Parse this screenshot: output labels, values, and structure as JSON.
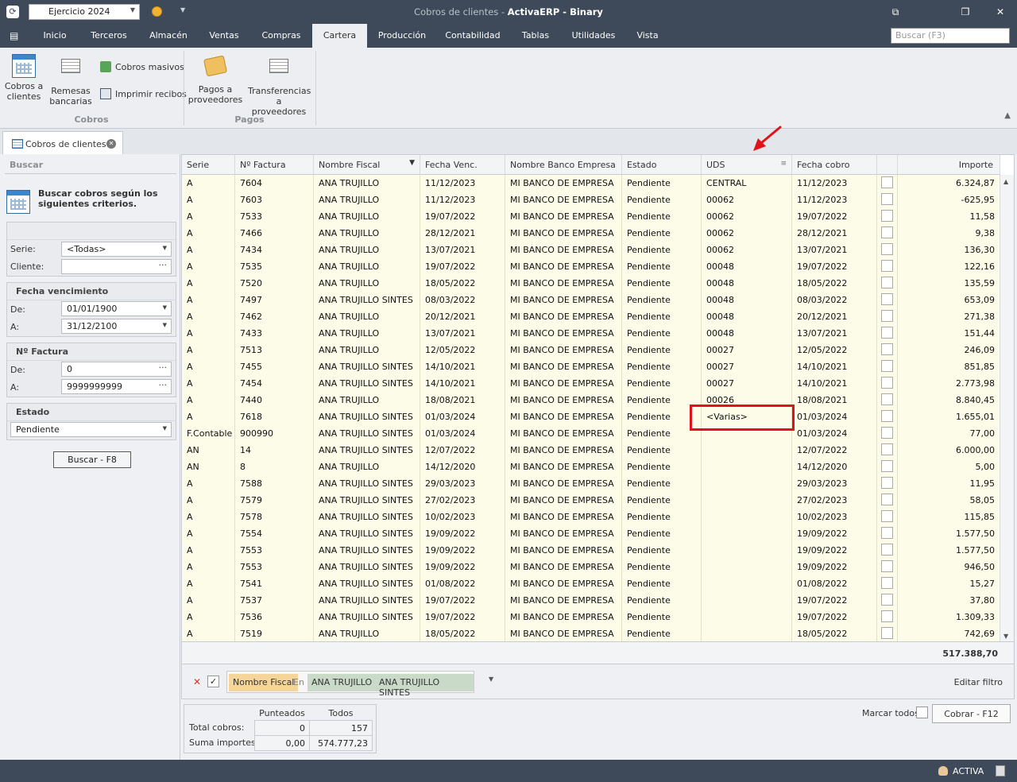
{
  "window": {
    "title_prefix": "Cobros de clientes - ",
    "title_app": "ActivaERP - Binary",
    "ejercicio": "Ejercicio 2024",
    "search_placeholder": "Buscar (F3)"
  },
  "menu": [
    "Inicio",
    "Terceros",
    "Almacén",
    "Ventas",
    "Compras",
    "Cartera",
    "Producción",
    "Contabilidad",
    "Tablas",
    "Utilidades",
    "Vista"
  ],
  "ribbon": {
    "cobros_clientes": "Cobros a clientes",
    "remesas": "Remesas bancarias",
    "cobros_masivos": "Cobros masivos",
    "imprimir_recibos": "Imprimir recibos",
    "group_cobros": "Cobros",
    "pagos_proveedores": "Pagos a proveedores",
    "transferencias": "Transferencias a proveedores",
    "group_pagos": "Pagos"
  },
  "tab": {
    "label": "Cobros de clientes"
  },
  "search_panel": {
    "title": "Buscar",
    "description": "Buscar cobros según los siguientes criterios.",
    "serie_label": "Serie:",
    "serie_value": "<Todas>",
    "cliente_label": "Cliente:",
    "cliente_value": "",
    "fecha_heading": "Fecha vencimiento",
    "de_label": "De:",
    "a_label": "A:",
    "fecha_de": "01/01/1900",
    "fecha_a": "31/12/2100",
    "factura_heading": "Nº Factura",
    "factura_de": "0",
    "factura_a": "9999999999",
    "estado_heading": "Estado",
    "estado_value": "Pendiente",
    "buscar_button": "Buscar - F8"
  },
  "grid": {
    "columns": [
      "Serie",
      "Nº Factura",
      "Nombre Fiscal",
      "Fecha Venc.",
      "Nombre Banco Empresa",
      "Estado",
      "UDS",
      "Fecha cobro",
      "",
      "Importe"
    ],
    "rows": [
      [
        "A",
        "7604",
        "ANA TRUJILLO",
        "11/12/2023",
        "MI BANCO DE EMPRESA",
        "Pendiente",
        "CENTRAL",
        "11/12/2023",
        "",
        "6.324,87"
      ],
      [
        "A",
        "7603",
        "ANA TRUJILLO",
        "11/12/2023",
        "MI BANCO DE EMPRESA",
        "Pendiente",
        "00062",
        "11/12/2023",
        "",
        "-625,95"
      ],
      [
        "A",
        "7533",
        "ANA TRUJILLO",
        "19/07/2022",
        "MI BANCO DE EMPRESA",
        "Pendiente",
        "00062",
        "19/07/2022",
        "",
        "11,58"
      ],
      [
        "A",
        "7466",
        "ANA TRUJILLO",
        "28/12/2021",
        "MI BANCO DE EMPRESA",
        "Pendiente",
        "00062",
        "28/12/2021",
        "",
        "9,38"
      ],
      [
        "A",
        "7434",
        "ANA TRUJILLO",
        "13/07/2021",
        "MI BANCO DE EMPRESA",
        "Pendiente",
        "00062",
        "13/07/2021",
        "",
        "136,30"
      ],
      [
        "A",
        "7535",
        "ANA TRUJILLO",
        "19/07/2022",
        "MI BANCO DE EMPRESA",
        "Pendiente",
        "00048",
        "19/07/2022",
        "",
        "122,16"
      ],
      [
        "A",
        "7520",
        "ANA TRUJILLO",
        "18/05/2022",
        "MI BANCO DE EMPRESA",
        "Pendiente",
        "00048",
        "18/05/2022",
        "",
        "135,59"
      ],
      [
        "A",
        "7497",
        "ANA TRUJILLO SINTES",
        "08/03/2022",
        "MI BANCO DE EMPRESA",
        "Pendiente",
        "00048",
        "08/03/2022",
        "",
        "653,09"
      ],
      [
        "A",
        "7462",
        "ANA TRUJILLO",
        "20/12/2021",
        "MI BANCO DE EMPRESA",
        "Pendiente",
        "00048",
        "20/12/2021",
        "",
        "271,38"
      ],
      [
        "A",
        "7433",
        "ANA TRUJILLO",
        "13/07/2021",
        "MI BANCO DE EMPRESA",
        "Pendiente",
        "00048",
        "13/07/2021",
        "",
        "151,44"
      ],
      [
        "A",
        "7513",
        "ANA TRUJILLO",
        "12/05/2022",
        "MI BANCO DE EMPRESA",
        "Pendiente",
        "00027",
        "12/05/2022",
        "",
        "246,09"
      ],
      [
        "A",
        "7455",
        "ANA TRUJILLO SINTES",
        "14/10/2021",
        "MI BANCO DE EMPRESA",
        "Pendiente",
        "00027",
        "14/10/2021",
        "",
        "851,85"
      ],
      [
        "A",
        "7454",
        "ANA TRUJILLO SINTES",
        "14/10/2021",
        "MI BANCO DE EMPRESA",
        "Pendiente",
        "00027",
        "14/10/2021",
        "",
        "2.773,98"
      ],
      [
        "A",
        "7440",
        "ANA TRUJILLO",
        "18/08/2021",
        "MI BANCO DE EMPRESA",
        "Pendiente",
        "00026",
        "18/08/2021",
        "",
        "8.840,45"
      ],
      [
        "A",
        "7618",
        "ANA TRUJILLO SINTES",
        "01/03/2024",
        "MI BANCO DE EMPRESA",
        "Pendiente",
        "<Varias>",
        "01/03/2024",
        "",
        "1.655,01"
      ],
      [
        "F.Contable",
        "900990",
        "ANA TRUJILLO SINTES",
        "01/03/2024",
        "MI BANCO DE EMPRESA",
        "Pendiente",
        "",
        "01/03/2024",
        "",
        "77,00"
      ],
      [
        "AN",
        "14",
        "ANA TRUJILLO SINTES",
        "12/07/2022",
        "MI BANCO DE EMPRESA",
        "Pendiente",
        "",
        "12/07/2022",
        "",
        "6.000,00"
      ],
      [
        "AN",
        "8",
        "ANA TRUJILLO",
        "14/12/2020",
        "MI BANCO DE EMPRESA",
        "Pendiente",
        "",
        "14/12/2020",
        "",
        "5,00"
      ],
      [
        "A",
        "7588",
        "ANA TRUJILLO SINTES",
        "29/03/2023",
        "MI BANCO DE EMPRESA",
        "Pendiente",
        "",
        "29/03/2023",
        "",
        "11,95"
      ],
      [
        "A",
        "7579",
        "ANA TRUJILLO SINTES",
        "27/02/2023",
        "MI BANCO DE EMPRESA",
        "Pendiente",
        "",
        "27/02/2023",
        "",
        "58,05"
      ],
      [
        "A",
        "7578",
        "ANA TRUJILLO SINTES",
        "10/02/2023",
        "MI BANCO DE EMPRESA",
        "Pendiente",
        "",
        "10/02/2023",
        "",
        "115,85"
      ],
      [
        "A",
        "7554",
        "ANA TRUJILLO SINTES",
        "19/09/2022",
        "MI BANCO DE EMPRESA",
        "Pendiente",
        "",
        "19/09/2022",
        "",
        "1.577,50"
      ],
      [
        "A",
        "7553",
        "ANA TRUJILLO SINTES",
        "19/09/2022",
        "MI BANCO DE EMPRESA",
        "Pendiente",
        "",
        "19/09/2022",
        "",
        "1.577,50"
      ],
      [
        "A",
        "7553",
        "ANA TRUJILLO SINTES",
        "19/09/2022",
        "MI BANCO DE EMPRESA",
        "Pendiente",
        "",
        "19/09/2022",
        "",
        "946,50"
      ],
      [
        "A",
        "7541",
        "ANA TRUJILLO SINTES",
        "01/08/2022",
        "MI BANCO DE EMPRESA",
        "Pendiente",
        "",
        "01/08/2022",
        "",
        "15,27"
      ],
      [
        "A",
        "7537",
        "ANA TRUJILLO SINTES",
        "19/07/2022",
        "MI BANCO DE EMPRESA",
        "Pendiente",
        "",
        "19/07/2022",
        "",
        "37,80"
      ],
      [
        "A",
        "7536",
        "ANA TRUJILLO SINTES",
        "19/07/2022",
        "MI BANCO DE EMPRESA",
        "Pendiente",
        "",
        "19/07/2022",
        "",
        "1.309,33"
      ],
      [
        "A",
        "7519",
        "ANA TRUJILLO",
        "18/05/2022",
        "MI BANCO DE EMPRESA",
        "Pendiente",
        "",
        "18/05/2022",
        "",
        "742,69"
      ]
    ],
    "total": "517.388,70"
  },
  "filter": {
    "field": "Nombre Fiscal",
    "op": "En",
    "values": [
      "ANA TRUJILLO",
      "ANA TRUJILLO SINTES"
    ],
    "edit": "Editar filtro"
  },
  "stats": {
    "col_punteados": "Punteados",
    "col_todos": "Todos",
    "total_cobros_label": "Total cobros:",
    "suma_label": "Suma importes:",
    "punteados_count": "0",
    "todos_count": "157",
    "punteados_sum": "0,00",
    "todos_sum": "574.777,23"
  },
  "actions": {
    "marcar_todos": "Marcar todos",
    "cobrar": "Cobrar - F12"
  },
  "status": {
    "user": "ACTIVA"
  },
  "colors": {
    "chrome": "#3e4a59",
    "row_bg": "#fdfce8",
    "highlight": "#e0131a"
  }
}
